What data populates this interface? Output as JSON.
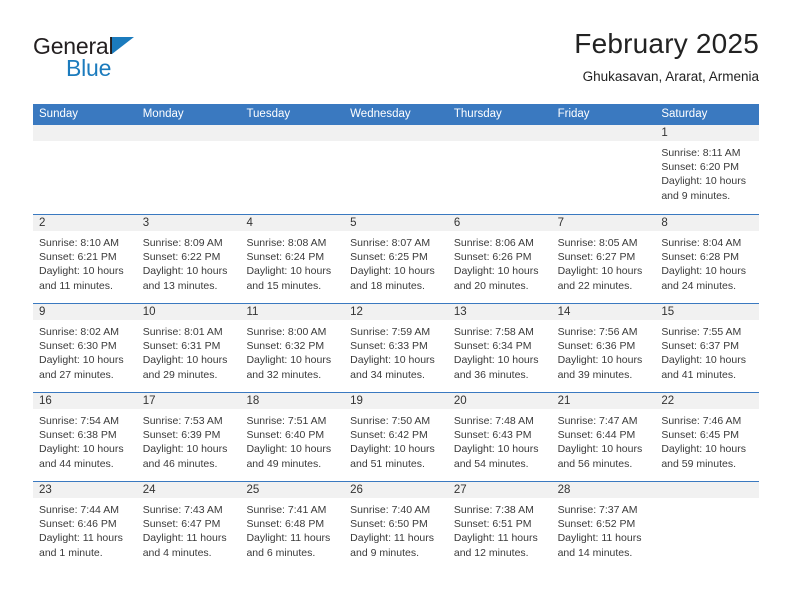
{
  "brand": {
    "line1": "General",
    "line2": "Blue",
    "triangle_icon": "brand-triangle-icon",
    "accent_color": "#1b7bbd"
  },
  "header": {
    "title": "February 2025",
    "subtitle": "Ghukasavan, Ararat, Armenia"
  },
  "theme": {
    "header_blue": "#3a79c0",
    "day_band_gray": "#f1f1f1",
    "text": "#3a3a3a"
  },
  "weekdays": [
    "Sunday",
    "Monday",
    "Tuesday",
    "Wednesday",
    "Thursday",
    "Friday",
    "Saturday"
  ],
  "weeks": [
    [
      {
        "day": "",
        "lines": []
      },
      {
        "day": "",
        "lines": []
      },
      {
        "day": "",
        "lines": []
      },
      {
        "day": "",
        "lines": []
      },
      {
        "day": "",
        "lines": []
      },
      {
        "day": "",
        "lines": []
      },
      {
        "day": "1",
        "lines": [
          "Sunrise: 8:11 AM",
          "Sunset: 6:20 PM",
          "Daylight: 10 hours and 9 minutes."
        ]
      }
    ],
    [
      {
        "day": "2",
        "lines": [
          "Sunrise: 8:10 AM",
          "Sunset: 6:21 PM",
          "Daylight: 10 hours and 11 minutes."
        ]
      },
      {
        "day": "3",
        "lines": [
          "Sunrise: 8:09 AM",
          "Sunset: 6:22 PM",
          "Daylight: 10 hours and 13 minutes."
        ]
      },
      {
        "day": "4",
        "lines": [
          "Sunrise: 8:08 AM",
          "Sunset: 6:24 PM",
          "Daylight: 10 hours and 15 minutes."
        ]
      },
      {
        "day": "5",
        "lines": [
          "Sunrise: 8:07 AM",
          "Sunset: 6:25 PM",
          "Daylight: 10 hours and 18 minutes."
        ]
      },
      {
        "day": "6",
        "lines": [
          "Sunrise: 8:06 AM",
          "Sunset: 6:26 PM",
          "Daylight: 10 hours and 20 minutes."
        ]
      },
      {
        "day": "7",
        "lines": [
          "Sunrise: 8:05 AM",
          "Sunset: 6:27 PM",
          "Daylight: 10 hours and 22 minutes."
        ]
      },
      {
        "day": "8",
        "lines": [
          "Sunrise: 8:04 AM",
          "Sunset: 6:28 PM",
          "Daylight: 10 hours and 24 minutes."
        ]
      }
    ],
    [
      {
        "day": "9",
        "lines": [
          "Sunrise: 8:02 AM",
          "Sunset: 6:30 PM",
          "Daylight: 10 hours and 27 minutes."
        ]
      },
      {
        "day": "10",
        "lines": [
          "Sunrise: 8:01 AM",
          "Sunset: 6:31 PM",
          "Daylight: 10 hours and 29 minutes."
        ]
      },
      {
        "day": "11",
        "lines": [
          "Sunrise: 8:00 AM",
          "Sunset: 6:32 PM",
          "Daylight: 10 hours and 32 minutes."
        ]
      },
      {
        "day": "12",
        "lines": [
          "Sunrise: 7:59 AM",
          "Sunset: 6:33 PM",
          "Daylight: 10 hours and 34 minutes."
        ]
      },
      {
        "day": "13",
        "lines": [
          "Sunrise: 7:58 AM",
          "Sunset: 6:34 PM",
          "Daylight: 10 hours and 36 minutes."
        ]
      },
      {
        "day": "14",
        "lines": [
          "Sunrise: 7:56 AM",
          "Sunset: 6:36 PM",
          "Daylight: 10 hours and 39 minutes."
        ]
      },
      {
        "day": "15",
        "lines": [
          "Sunrise: 7:55 AM",
          "Sunset: 6:37 PM",
          "Daylight: 10 hours and 41 minutes."
        ]
      }
    ],
    [
      {
        "day": "16",
        "lines": [
          "Sunrise: 7:54 AM",
          "Sunset: 6:38 PM",
          "Daylight: 10 hours and 44 minutes."
        ]
      },
      {
        "day": "17",
        "lines": [
          "Sunrise: 7:53 AM",
          "Sunset: 6:39 PM",
          "Daylight: 10 hours and 46 minutes."
        ]
      },
      {
        "day": "18",
        "lines": [
          "Sunrise: 7:51 AM",
          "Sunset: 6:40 PM",
          "Daylight: 10 hours and 49 minutes."
        ]
      },
      {
        "day": "19",
        "lines": [
          "Sunrise: 7:50 AM",
          "Sunset: 6:42 PM",
          "Daylight: 10 hours and 51 minutes."
        ]
      },
      {
        "day": "20",
        "lines": [
          "Sunrise: 7:48 AM",
          "Sunset: 6:43 PM",
          "Daylight: 10 hours and 54 minutes."
        ]
      },
      {
        "day": "21",
        "lines": [
          "Sunrise: 7:47 AM",
          "Sunset: 6:44 PM",
          "Daylight: 10 hours and 56 minutes."
        ]
      },
      {
        "day": "22",
        "lines": [
          "Sunrise: 7:46 AM",
          "Sunset: 6:45 PM",
          "Daylight: 10 hours and 59 minutes."
        ]
      }
    ],
    [
      {
        "day": "23",
        "lines": [
          "Sunrise: 7:44 AM",
          "Sunset: 6:46 PM",
          "Daylight: 11 hours and 1 minute."
        ]
      },
      {
        "day": "24",
        "lines": [
          "Sunrise: 7:43 AM",
          "Sunset: 6:47 PM",
          "Daylight: 11 hours and 4 minutes."
        ]
      },
      {
        "day": "25",
        "lines": [
          "Sunrise: 7:41 AM",
          "Sunset: 6:48 PM",
          "Daylight: 11 hours and 6 minutes."
        ]
      },
      {
        "day": "26",
        "lines": [
          "Sunrise: 7:40 AM",
          "Sunset: 6:50 PM",
          "Daylight: 11 hours and 9 minutes."
        ]
      },
      {
        "day": "27",
        "lines": [
          "Sunrise: 7:38 AM",
          "Sunset: 6:51 PM",
          "Daylight: 11 hours and 12 minutes."
        ]
      },
      {
        "day": "28",
        "lines": [
          "Sunrise: 7:37 AM",
          "Sunset: 6:52 PM",
          "Daylight: 11 hours and 14 minutes."
        ]
      },
      {
        "day": "",
        "lines": []
      }
    ]
  ]
}
